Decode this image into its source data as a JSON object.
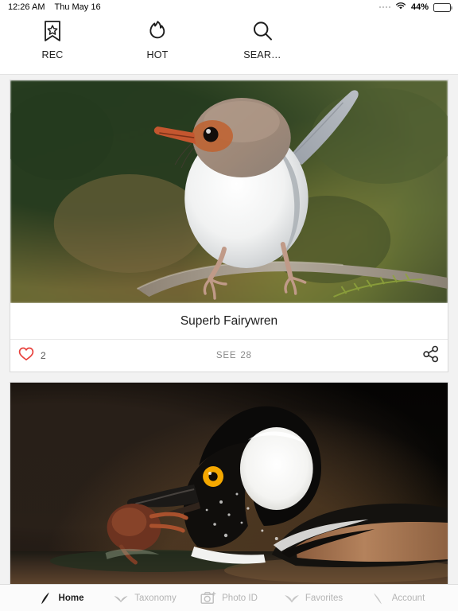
{
  "status_bar": {
    "time": "12:26 AM",
    "date": "Thu May 16",
    "battery_percent": "44%",
    "battery_level": 44,
    "wifi_icon": "wifi-icon",
    "dots_icon": "signal-dots-icon",
    "battery_icon": "battery-icon"
  },
  "toolbar": {
    "items": [
      {
        "label": "REC",
        "icon": "bookmark-star-icon"
      },
      {
        "label": "HOT",
        "icon": "flame-icon"
      },
      {
        "label": "SEAR…",
        "icon": "search-icon"
      }
    ]
  },
  "feed": {
    "cards": [
      {
        "title": "Superb Fairywren",
        "photo_alt": "superb-fairywren-photo",
        "like_icon": "heart-icon",
        "like_count": "2",
        "see_label": "SEE",
        "see_count": "28",
        "share_icon": "share-icon"
      },
      {
        "title": "",
        "photo_alt": "hooded-merganser-photo"
      }
    ]
  },
  "tabbar": {
    "items": [
      {
        "label": "Home",
        "icon": "feather-icon",
        "active": true
      },
      {
        "label": "Taxonomy",
        "icon": "bird-icon",
        "active": false
      },
      {
        "label": "Photo ID",
        "icon": "camera-plus-icon",
        "active": false
      },
      {
        "label": "Favorites",
        "icon": "bird-icon",
        "active": false
      },
      {
        "label": "Account",
        "icon": "feather-icon",
        "active": false
      }
    ]
  },
  "colors": {
    "accent_heart": "#e8413c",
    "background": "#f2f2f2",
    "card": "#ffffff",
    "text_primary": "#1d1d1d",
    "text_muted": "#8a8a8a",
    "tab_inactive": "#b4b4b4"
  }
}
